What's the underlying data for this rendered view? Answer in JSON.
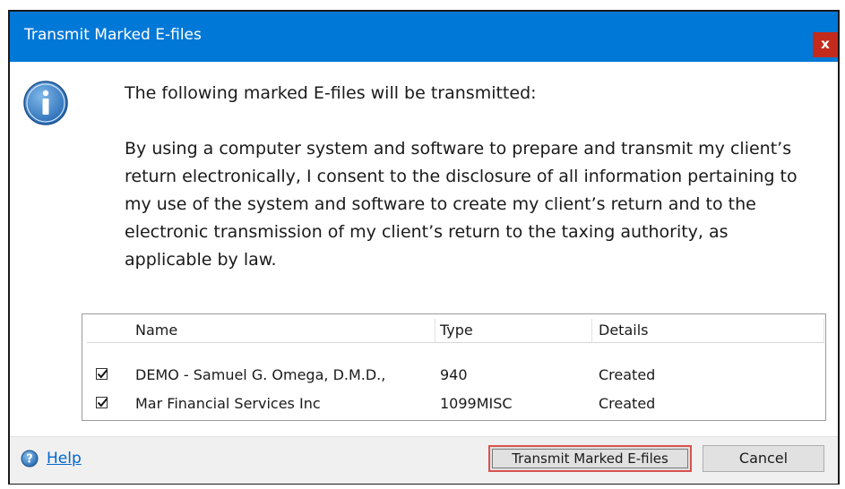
{
  "window": {
    "title": "Transmit Marked E-files",
    "close_label": "x"
  },
  "message": {
    "heading": "The following marked E-files will be transmitted:",
    "consent": "By using a computer system and software to prepare and transmit my client’s return electronically, I consent to the disclosure of all information pertaining to my use of the system and software to create my client’s return and to the electronic transmission of my client’s return to the taxing authority, as applicable by law."
  },
  "files": {
    "columns": [
      "Name",
      "Type",
      "Details"
    ],
    "rows": [
      {
        "checked": true,
        "name": "DEMO - Samuel G. Omega, D.M.D.,",
        "type": "940",
        "details": "Created"
      },
      {
        "checked": true,
        "name": "Mar Financial Services Inc",
        "type": "1099MISC",
        "details": "Created"
      }
    ]
  },
  "footer": {
    "help_label": "Help",
    "transmit_label": "Transmit Marked E-files",
    "cancel_label": "Cancel"
  },
  "colors": {
    "titlebar": "#0078d7",
    "close": "#c42b1c",
    "highlight": "#d9534f",
    "link": "#0066cc"
  },
  "icons": {
    "info": "info-icon",
    "help": "help-icon",
    "check": "checkmark-icon"
  }
}
